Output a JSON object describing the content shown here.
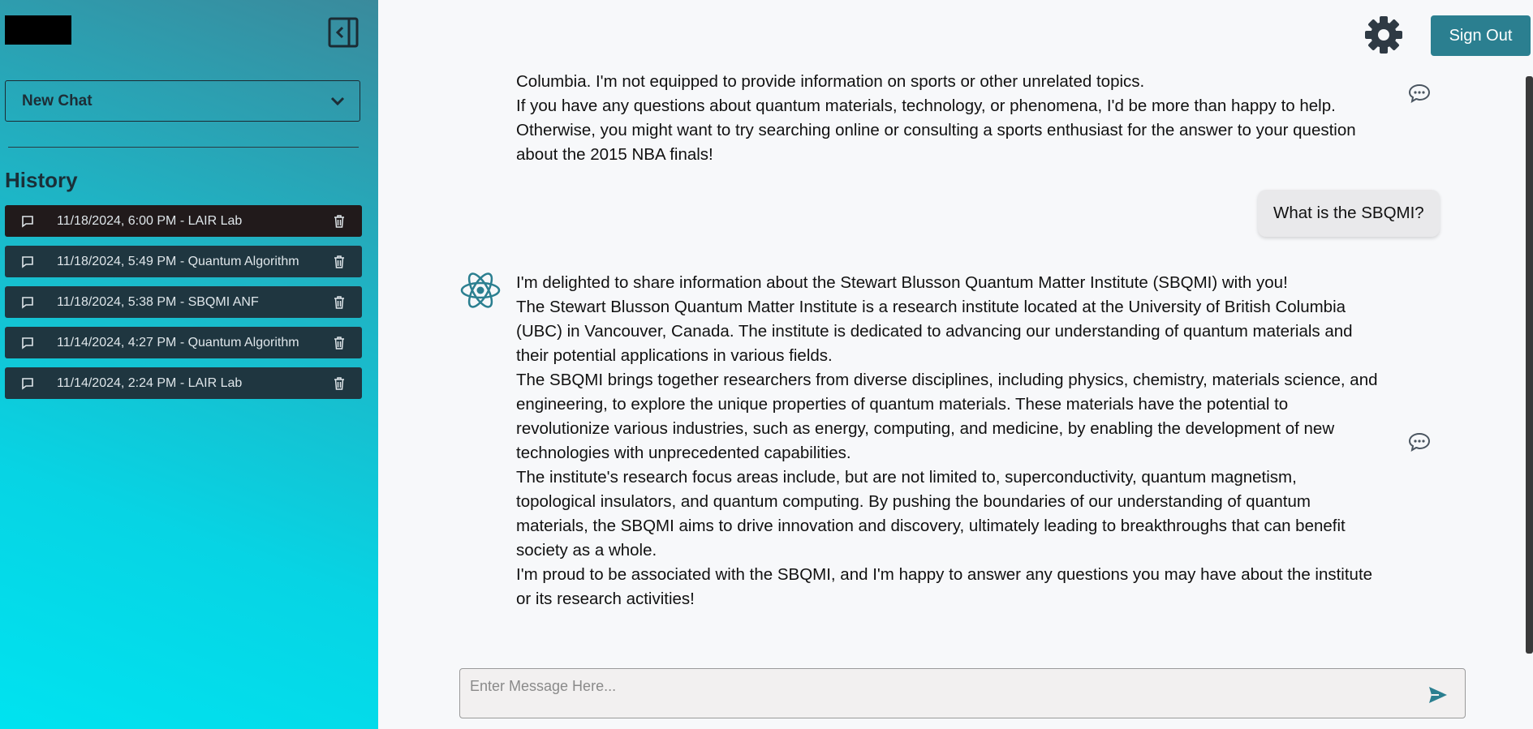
{
  "sidebar": {
    "model_select": {
      "label": "New Chat"
    },
    "history_heading": "History",
    "history": [
      {
        "label": "11/18/2024, 6:00 PM - LAIR Lab",
        "active": true
      },
      {
        "label": "11/18/2024, 5:49 PM - Quantum Algorithm",
        "active": false
      },
      {
        "label": "11/18/2024, 5:38 PM - SBQMI ANF",
        "active": false
      },
      {
        "label": "11/14/2024, 4:27 PM - Quantum Algorithm",
        "active": false
      },
      {
        "label": "11/14/2024, 2:24 PM - LAIR Lab",
        "active": false
      }
    ],
    "icons": {
      "collapse": "collapse-sidebar-icon",
      "chevron": "chevron-down-icon",
      "item": "chat-bubble-icon",
      "delete": "trash-icon"
    }
  },
  "header": {
    "settings_icon": "gear-icon",
    "signout_label": "Sign Out"
  },
  "chat": {
    "previous_response": [
      "Columbia. I'm not equipped to provide information on sports or other unrelated topics.",
      "If you have any questions about quantum materials, technology, or phenomena, I'd be more than happy to help. Otherwise, you might want to try searching online or consulting a sports enthusiast for the answer to your question about the 2015 NBA finals!"
    ],
    "user_message": "What is the SBQMI?",
    "bot_response": [
      "I'm delighted to share information about the Stewart Blusson Quantum Matter Institute (SBQMI) with you!",
      "The Stewart Blusson Quantum Matter Institute is a research institute located at the University of British Columbia (UBC) in Vancouver, Canada. The institute is dedicated to advancing our understanding of quantum materials and their potential applications in various fields.",
      "The SBQMI brings together researchers from diverse disciplines, including physics, chemistry, materials science, and engineering, to explore the unique properties of quantum materials. These materials have the potential to revolutionize various industries, such as energy, computing, and medicine, by enabling the development of new technologies with unprecedented capabilities.",
      "The institute's research focus areas include, but are not limited to, superconductivity, quantum magnetism, topological insulators, and quantum computing. By pushing the boundaries of our understanding of quantum materials, the SBQMI aims to drive innovation and discovery, ultimately leading to breakthroughs that can benefit society as a whole.",
      "I'm proud to be associated with the SBQMI, and I'm happy to answer any questions you may have about the institute or its research activities!"
    ],
    "bot_avatar_icon": "atom-icon",
    "feedback_icon": "comment-icon"
  },
  "input": {
    "placeholder": "Enter Message Here...",
    "value": "",
    "send_icon": "send-icon"
  },
  "colors": {
    "accent": "#2b7f90",
    "history_item_bg": "#1f3640",
    "history_item_active_bg": "#211a1b",
    "sidebar_gradient_top": "#3a8a9c",
    "sidebar_gradient_bottom": "#00e3f0"
  }
}
